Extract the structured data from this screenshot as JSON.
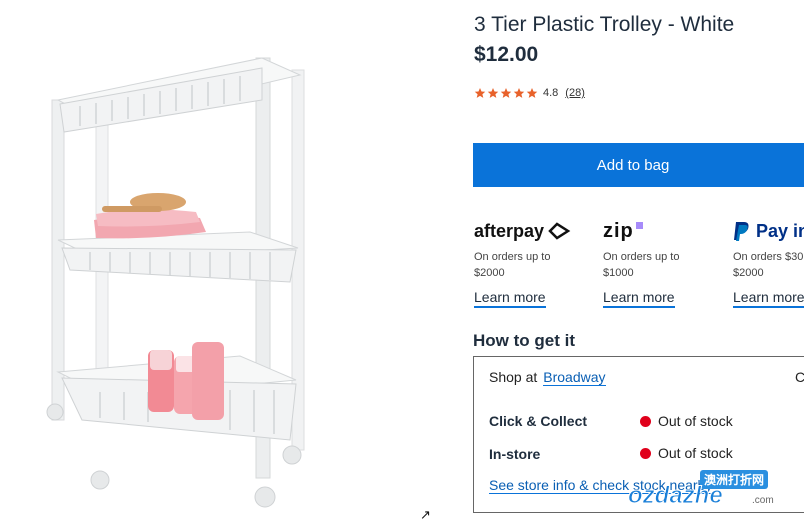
{
  "product": {
    "title": "3 Tier Plastic Trolley - White",
    "price": "$12.00",
    "rating_value": "4.8",
    "rating_count": "(28)",
    "stars": 5,
    "star_color": "#e8622b",
    "image_icon": "product-photo-trolley"
  },
  "cart": {
    "add_label": "Add to bag",
    "button_color": "#0a73d9"
  },
  "payments": [
    {
      "name": "afterpay",
      "text": "On orders up to\n$2000",
      "link": "Learn more"
    },
    {
      "name": "zip",
      "text": "On orders up to\n$1000",
      "link": "Learn more"
    },
    {
      "name": "Pay in",
      "text": "On orders $30\n$2000",
      "link": "Learn more"
    }
  ],
  "fulfilment": {
    "heading": "How to get it",
    "shop_at_label": "Shop at",
    "store": "Broadway",
    "shop_extra": "C",
    "rows": [
      {
        "label": "Click & Collect",
        "status": "Out of stock"
      },
      {
        "label": "In-store",
        "status": "Out of stock"
      }
    ],
    "store_info_link": "See store info & check stock nearby",
    "status_color": "#e0001b"
  },
  "watermark": {
    "cn": "澳洲打折网",
    "main": "ozdazhe",
    "domain": ".com"
  }
}
